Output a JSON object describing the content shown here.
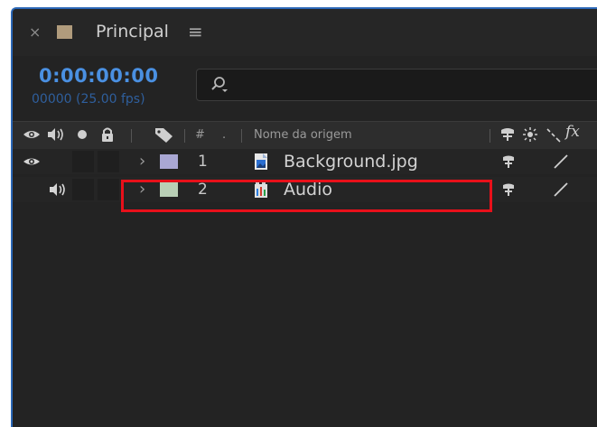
{
  "window": {
    "tab_title": "Principal",
    "close_glyph": "×",
    "menu_glyph": "≡",
    "label_color": "#b09b7c"
  },
  "time": {
    "timecode": "0:00:00:00",
    "frames_fps": "00000 (25.00 fps)"
  },
  "search": {
    "value": "",
    "placeholder": "",
    "icon": "search-icon"
  },
  "columns": {
    "av_icons": [
      "eye-icon",
      "speaker-icon",
      "solo-dot-icon",
      "lock-icon"
    ],
    "label_icon": "tag-icon",
    "number_header": "#",
    "dot_header": ".",
    "source_name": "Nome da origem",
    "switches": [
      "shy-icon",
      "collapse-icon",
      "quality-icon",
      "fx-icon"
    ],
    "fx_text": "fx"
  },
  "layers": [
    {
      "number": "1",
      "name": "Background.jpg",
      "label_color": "#a9a7d3",
      "has_video": true,
      "has_audio": false,
      "file_icon": "image-file-icon"
    },
    {
      "number": "2",
      "name": "Audio",
      "label_color": "#b9cfb6",
      "has_video": false,
      "has_audio": true,
      "file_icon": "audio-file-icon"
    }
  ],
  "highlight": {
    "target_layer": "2",
    "color": "#e8101a"
  },
  "colors": {
    "accent": "#4a90e2",
    "panel_border": "#2b67b6",
    "background": "#232323"
  }
}
